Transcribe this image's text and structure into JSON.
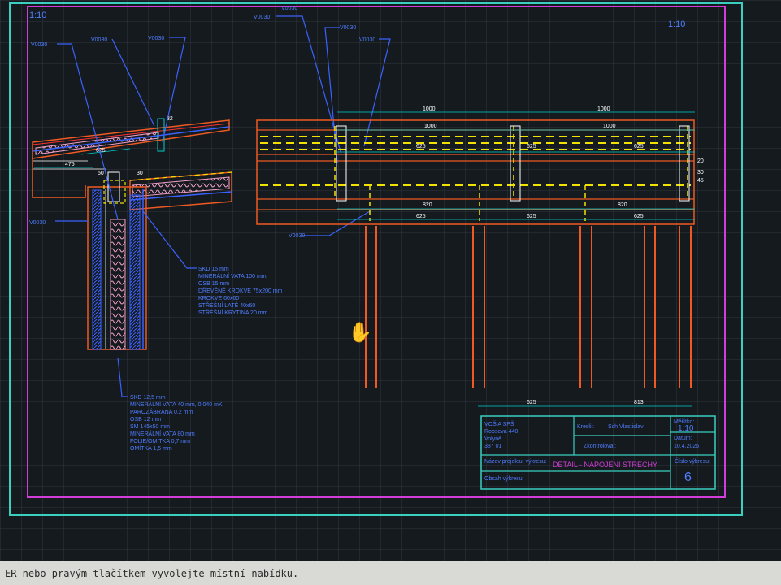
{
  "scale_labels": {
    "top_left": "1:10",
    "top_right": "1:10"
  },
  "callouts": {
    "v1": "V0030",
    "v2": "V0030",
    "v3": "V0030",
    "v4": "V0030",
    "v5": "V0030",
    "v6": "V0030",
    "v7": "V0030",
    "v8": "V0030",
    "v9": "V0030"
  },
  "dimensions": {
    "left": {
      "d32": "32",
      "d625": "625",
      "d475": "475",
      "d50": "50",
      "d30": "30"
    },
    "right": {
      "top_a": "1000",
      "top_b": "1000",
      "mid_a": "1000",
      "mid_b": "1000",
      "s1": "625",
      "s2": "625",
      "s3": "625",
      "b1": "820",
      "b2": "820",
      "b3": "625",
      "b4": "625",
      "b5": "625",
      "r1": "20",
      "r2": "30",
      "r3": "45",
      "low_a": "625",
      "low_b": "813"
    }
  },
  "notes": {
    "block1": [
      "SKD 15 mm",
      "MINERÁLNÍ VATA 100 mm",
      "OSB 15 mm",
      "DŘEVĚNÉ KROKVE 75x200 mm",
      "KROKVE 60x60",
      "STŘEŠNÍ LATĚ 40x60",
      "STŘEŠNÍ KRYTINA 20 mm"
    ],
    "block2": [
      "SKD 12,5 mm",
      "MINERÁLNÍ VATA 40 mm, 0,040 mK",
      "PAROZÁBRANA 0,2 mm",
      "OSB 12 mm",
      "SM 145x50 mm",
      "MINERÁLNÍ VATA 80 mm",
      "FOLIE/OMÍTKA 0,7 mm",
      "OMÍTKA 1,5 mm"
    ]
  },
  "title_block": {
    "school": [
      "VOŠ A SPŠ",
      "Rooseva 440",
      "Volyně",
      "387 01"
    ],
    "author_label": "Kreslil:",
    "author": "Sch Vlastislav",
    "checked_label": "Zkontroloval:",
    "scale_label": "Měřítko:",
    "scale": "1:10",
    "date_label": "Datum:",
    "date": "10.4.2026",
    "project_label": "Název projektu, výkresu:",
    "project": "DETAIL - NAPOJENÍ STŘECHY",
    "drawing_no_label": "Číslo výkresu:",
    "drawing_no": "6",
    "drawing_label": "Obsah výkresu:"
  },
  "command_line": "ER nebo pravým tlačítkem vyvolejte místní nabídku.",
  "colors": {
    "background": "#151a1e",
    "grid": "#2e363c",
    "frame_outer": "#39d0c0",
    "frame_inner": "#d23cd8",
    "structure": "#ef5a22",
    "dim": "#00d0d0",
    "hidden": "#f2e200",
    "text_blue": "#4f7dff",
    "insulation": "#f0a0c8"
  }
}
